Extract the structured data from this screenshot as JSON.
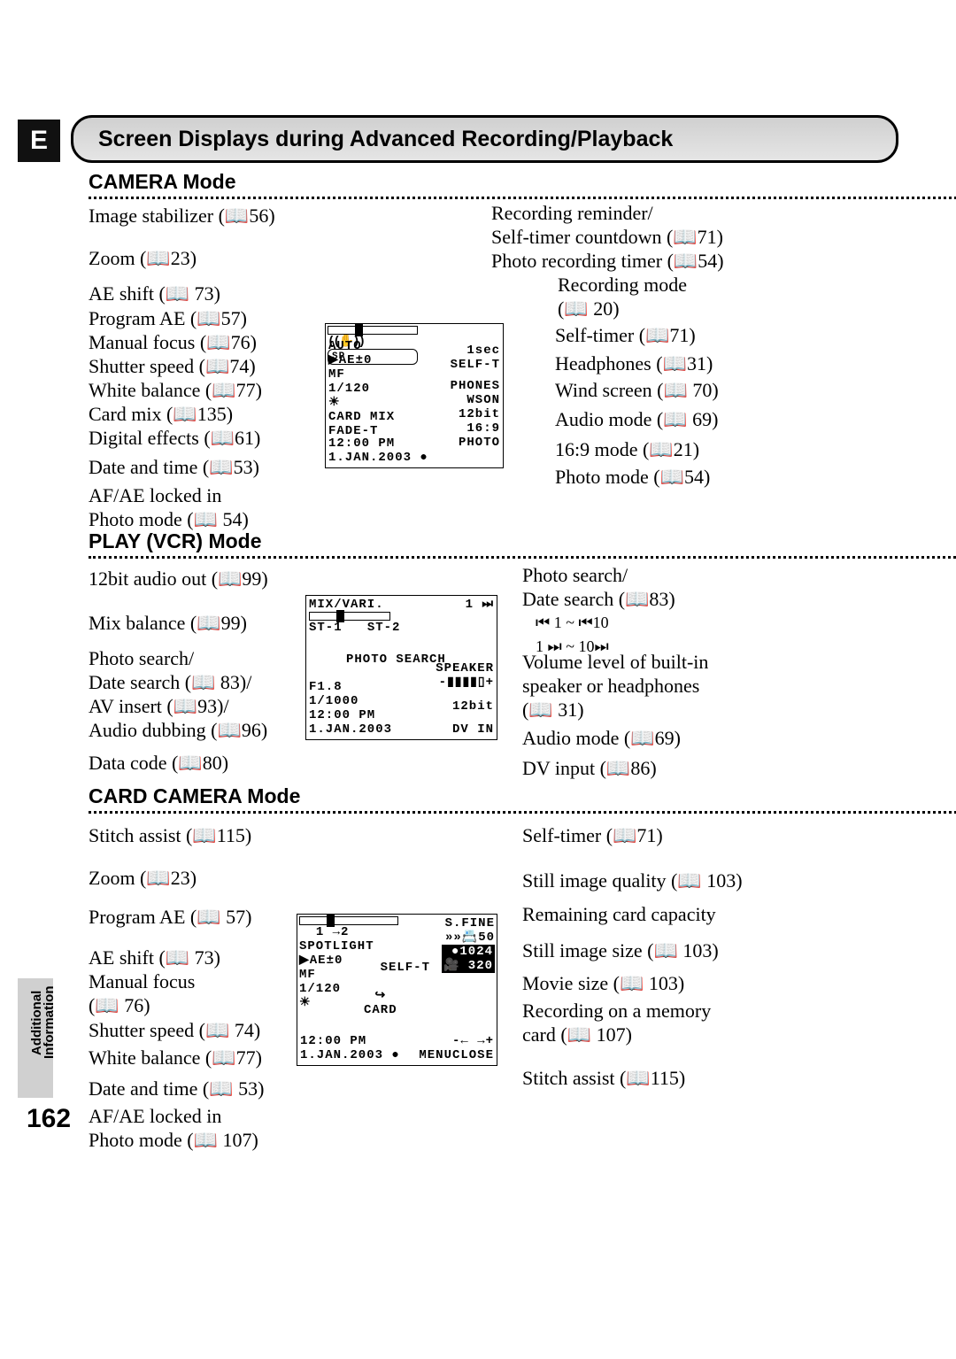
{
  "page_letter": "E",
  "page_number": "162",
  "side_tab": "Additional\nInformation",
  "heading": "Screen Displays during Advanced Recording/Playback",
  "camera": {
    "title": "CAMERA Mode",
    "left": {
      "stabilizer": "Image stabilizer (📖56)",
      "zoom": "Zoom (📖23)",
      "ae_shift": "AE shift (📖 73)",
      "program_ae": "Program AE (📖57)",
      "manual_focus": "Manual focus (📖76)",
      "shutter_speed": "Shutter speed (📖74)",
      "white_balance": "White balance (📖77)",
      "card_mix": "Card mix (📖135)",
      "digital_effects": "Digital effects (📖61)",
      "date_time": "Date and time (📖53)",
      "afae": "AF/AE locked in\nPhoto mode (📖 54)"
    },
    "right": {
      "rec_reminder": "Recording reminder/\nSelf-timer countdown (📖71)\nPhoto recording timer (📖54)",
      "rec_mode": "Recording mode\n(📖 20)",
      "self_timer": "Self-timer (📖71)",
      "headphones": "Headphones (📖31)",
      "wind_screen": "Wind screen (📖 70)",
      "audio_mode": "Audio mode (📖 69)",
      "mode169": "16:9 mode (📖21)",
      "photo_mode": "Photo mode (📖54)"
    },
    "lcd": {
      "auto": "AUTO",
      "ae": "▶AE±0",
      "mf": "MF",
      "shutter": "1/120",
      "wb": "☀",
      "cardmix": "CARD MIX",
      "fade": "FADE-T",
      "time": "12:00 PM",
      "date": "1.JAN.2003 ●",
      "onesec": "1sec",
      "selft": "SELF-T",
      "phones": "PHONES",
      "wson": "WSON",
      "bit": "12bit",
      "r169": "16:9",
      "photo": "PHOTO",
      "sp": "SP"
    }
  },
  "vcr": {
    "title": "PLAY (VCR) Mode",
    "left": {
      "audio_out": "12bit audio out (📖99)",
      "mix_balance": "Mix balance (📖99)",
      "photo_date_av_dub": "Photo search/\nDate search (📖 83)/\nAV insert (📖93)/\nAudio dubbing (📖96)",
      "data_code": "Data code (📖80)"
    },
    "right": {
      "photo_date": "Photo search/\nDate search (📖83)",
      "nav": "⏮ 1 ~ ⏮10\n1 ⏭ ~ 10⏭",
      "volume": "Volume level of built-in\nspeaker or headphones\n(📖 31)",
      "audio_mode": "Audio mode (📖69)",
      "dv_input": "DV input (📖86)"
    },
    "lcd": {
      "mix": "MIX/VARI.",
      "st1": "ST-1",
      "st2": "ST-2",
      "photo_search": "PHOTO SEARCH",
      "speaker": "SPEAKER",
      "vol": "-▮▮▮▮▯+",
      "f": "F1.8",
      "shutter": "1/1000",
      "time": "12:00 PM",
      "date": "1.JAN.2003",
      "bit": "12bit",
      "dvin": "DV IN",
      "one": "1 ⏭"
    }
  },
  "card": {
    "title": "CARD CAMERA Mode",
    "left": {
      "stitch": "Stitch assist (📖115)",
      "zoom": "Zoom (📖23)",
      "program_ae": "Program AE (📖 57)",
      "ae_shift": "AE shift (📖 73)",
      "manual_focus": "Manual focus\n(📖 76)",
      "shutter_speed": "Shutter speed (📖 74)",
      "white_balance": "White balance (📖77)",
      "date_time": "Date and time (📖 53)",
      "afae": "AF/AE locked in\nPhoto mode (📖 107)"
    },
    "right": {
      "self_timer": "Self-timer (📖71)",
      "still_quality": "Still image quality (📖 103)",
      "remaining": "Remaining card capacity",
      "still_size": "Still image size (📖 103)",
      "movie_size": "Movie size (📖 103)",
      "rec_card": "Recording on a memory\ncard (📖 107)",
      "stitch2": "Stitch assist (📖115)"
    },
    "lcd": {
      "spotlight": "SPOTLIGHT",
      "ae": "▶AE±0",
      "mf": "MF",
      "shutter": "1/120",
      "wb": "☀",
      "sfine": "S.FINE",
      "sfine_icon": "»»📇50",
      "size1": "●1024",
      "size2": "🎥 320",
      "selft": "SELF-T",
      "onetwo": "1 →2",
      "card_icon": "↪\nCARD",
      "time": "12:00 PM",
      "date": "1.JAN.2003 ●",
      "menuclose": "-← →+\nMENUCLOSE"
    }
  }
}
